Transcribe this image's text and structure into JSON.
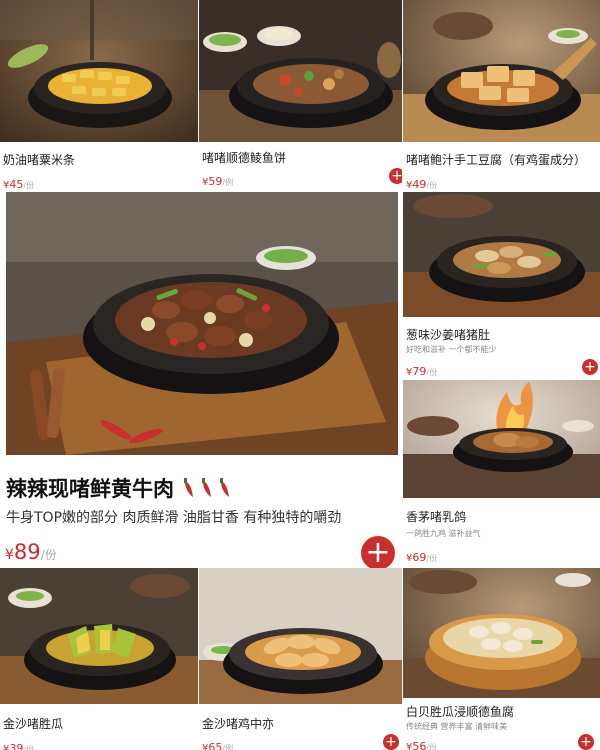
{
  "colors": {
    "accent": "#c8302e",
    "price": "#d0282e"
  },
  "menu": {
    "items": [
      {
        "name": "奶油啫粟米条",
        "currency": "¥",
        "price": "45",
        "unit": "/份"
      },
      {
        "name": "啫啫顺德鲮鱼饼",
        "currency": "¥",
        "price": "59",
        "unit": "/例"
      },
      {
        "name": "啫啫鲍汁手工豆腐（有鸡蛋成分）",
        "currency": "¥",
        "price": "49",
        "unit": "/份"
      },
      {
        "name": "葱味沙姜啫猪肚",
        "desc": "好吃和滋补 一个都不能少",
        "currency": "¥",
        "price": "79",
        "unit": "/份"
      },
      {
        "name": "香茅啫乳鸽",
        "desc": "一鸽胜九鸡 滋补益气",
        "currency": "¥",
        "price": "69",
        "unit": "/份"
      },
      {
        "name": "金沙啫胜瓜",
        "currency": "¥",
        "price": "39",
        "unit": "/份"
      },
      {
        "name": "金沙啫鸡中亦",
        "currency": "¥",
        "price": "65",
        "unit": "/例"
      },
      {
        "name": "白贝胜瓜浸顺德鱼腐",
        "desc": "传统经典 营养丰富 清鲜味美",
        "currency": "¥",
        "price": "56",
        "unit": "/份"
      }
    ],
    "featured": {
      "name": "辣辣现啫鲜黄牛肉",
      "desc": "牛身TOP嫩的部分 肉质鲜滑 油脂甘香 有种独特的嚼劲",
      "currency": "¥",
      "price": "89",
      "unit": "/份"
    },
    "add_symbol": "+"
  }
}
